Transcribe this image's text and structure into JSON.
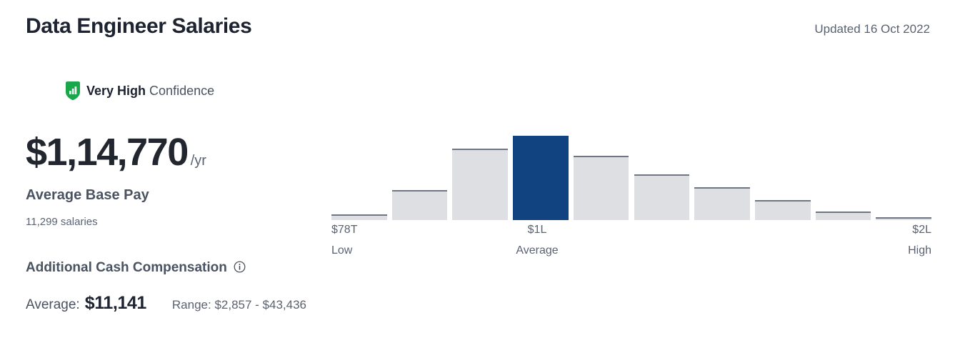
{
  "header": {
    "title": "Data Engineer Salaries",
    "updated": "Updated 16 Oct 2022"
  },
  "confidence": {
    "icon": "shield-bar-chart-icon",
    "level": "Very High",
    "label": "Confidence",
    "color": "#1aa64b"
  },
  "base_pay": {
    "amount": "$1,14,770",
    "unit": "/yr",
    "label": "Average Base Pay",
    "count": "11,299 salaries"
  },
  "additional_cash": {
    "heading": "Additional Cash Compensation",
    "info_icon": "info-circle-icon",
    "average_label": "Average:",
    "average_value": "$11,141",
    "range": "Range: $2,857 - $43,436"
  },
  "chart_data": {
    "type": "bar",
    "title": "",
    "xlabel": "",
    "ylabel": "",
    "grid": false,
    "legend": false,
    "categories": [
      "b1",
      "b2",
      "b3",
      "b4",
      "b5",
      "b6",
      "b7",
      "b8",
      "b9",
      "b10"
    ],
    "values": [
      8,
      42,
      100,
      118,
      90,
      64,
      46,
      28,
      12,
      4
    ],
    "ylim": [
      0,
      122
    ],
    "highlight_index": 3,
    "highlight_color": "#10437f",
    "bar_color": "#dedfe3",
    "bar_border_color": "#6e7683",
    "axis_ticks": [
      {
        "value": "$78T",
        "name": "Low"
      },
      {
        "value": "$1L",
        "name": "Average"
      },
      {
        "value": "$2L",
        "name": "High"
      }
    ]
  }
}
